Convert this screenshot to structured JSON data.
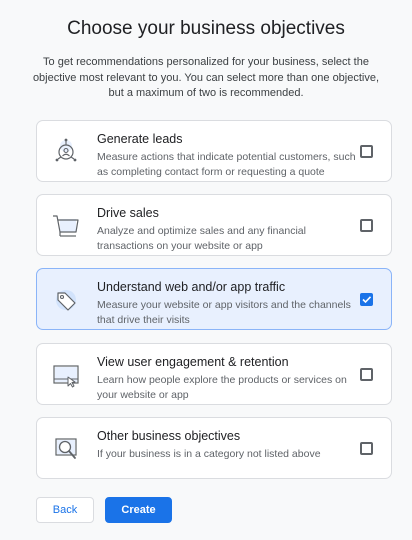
{
  "header": {
    "title": "Choose your business objectives",
    "subtitle": "To get recommendations personalized for your business, select the objective most relevant to you. You can select more than one objective, but a maximum of two is recommended."
  },
  "objectives": [
    {
      "title": "Generate leads",
      "description": "Measure actions that indicate potential customers, such as completing contact form or requesting a quote",
      "icon": "leads-icon",
      "checked": false
    },
    {
      "title": "Drive sales",
      "description": "Analyze and optimize sales and any financial transactions on your website or app",
      "icon": "shopping-cart-icon",
      "checked": false
    },
    {
      "title": "Understand web and/or app traffic",
      "description": "Measure your website or app visitors and the channels that drive their visits",
      "icon": "tag-icon",
      "checked": true
    },
    {
      "title": "View user engagement & retention",
      "description": "Learn how people explore the products or services on your website or app",
      "icon": "screen-cursor-icon",
      "checked": false
    },
    {
      "title": "Other business objectives",
      "description": "If your business is in a category not listed above",
      "icon": "magnifier-icon",
      "checked": false
    }
  ],
  "footer": {
    "back_label": "Back",
    "create_label": "Create"
  },
  "colors": {
    "accent": "#1a73e8",
    "selected_bg": "#e8f0fe",
    "border": "#dadce0"
  }
}
